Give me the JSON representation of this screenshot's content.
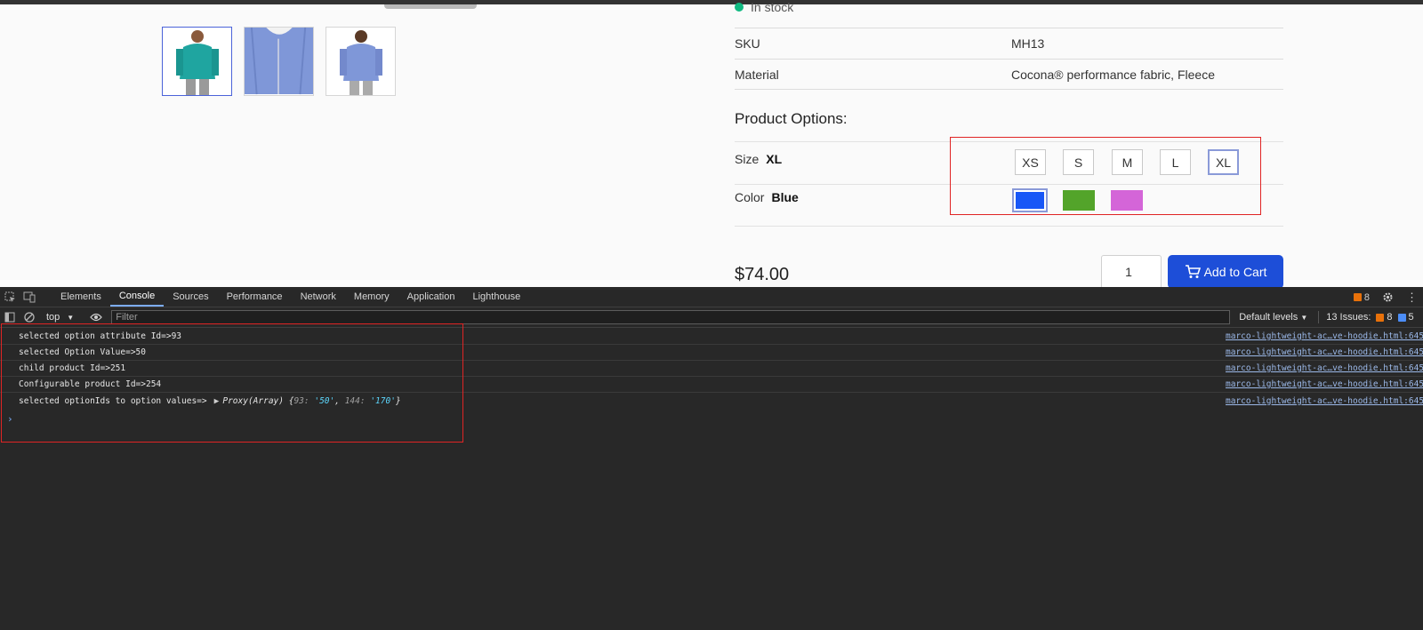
{
  "product": {
    "stock_status": "In stock",
    "attributes": [
      {
        "label": "SKU",
        "value": "MH13"
      },
      {
        "label": "Material",
        "value": "Cocona® performance fabric, Fleece"
      }
    ],
    "options_title": "Product Options:",
    "size": {
      "label": "Size",
      "selected": "XL",
      "choices": [
        "XS",
        "S",
        "M",
        "L",
        "XL"
      ]
    },
    "color": {
      "label": "Color",
      "selected": "Blue",
      "swatches": [
        "#1857f7",
        "#53a42a",
        "#d465d8"
      ]
    },
    "price": "$74.00",
    "quantity": "1",
    "add_to_cart_label": "Add to Cart"
  },
  "devtools": {
    "tabs": [
      "Elements",
      "Console",
      "Sources",
      "Performance",
      "Network",
      "Memory",
      "Application",
      "Lighthouse"
    ],
    "active_tab": "Console",
    "issues_badge": "8",
    "context": "top",
    "filter_placeholder": "Filter",
    "levels": "Default levels",
    "issues_label": "13 Issues:",
    "issues_warn": "8",
    "issues_info": "5",
    "logs": [
      {
        "message": "selected option attribute Id=>93",
        "source": "marco-lightweight-ac…ve-hoodie.html:645"
      },
      {
        "message": "selected Option Value=>50",
        "source": "marco-lightweight-ac…ve-hoodie.html:645"
      },
      {
        "message": "child product Id=>251",
        "source": "marco-lightweight-ac…ve-hoodie.html:645"
      },
      {
        "message": "Configurable product Id=>254",
        "source": "marco-lightweight-ac…ve-hoodie.html:645"
      },
      {
        "message": "selected optionIds to option values=>",
        "source": "marco-lightweight-ac…ve-hoodie.html:645"
      }
    ],
    "proxy": {
      "type": "Proxy(Array)",
      "entries": [
        {
          "key": "93",
          "value": "'50'"
        },
        {
          "key": "144",
          "value": "'170'"
        }
      ]
    }
  },
  "colors": {
    "accent": "#1d4ed8",
    "in_stock": "#10b981",
    "highlight": "#e02424",
    "devtools_bg": "#282828"
  }
}
